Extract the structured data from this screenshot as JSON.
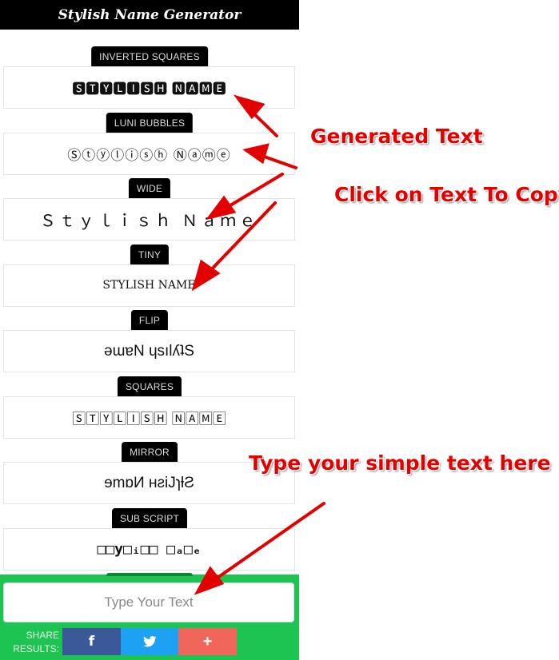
{
  "app": {
    "title": "Stylish Name Generator"
  },
  "sections": [
    {
      "label": "INVERTED SQUARES",
      "text": "🆂🆃🆈🅻🅸🆂🅷 🅽🅰🅼🅴"
    },
    {
      "label": "LUNI BUBBLES",
      "text": "Ⓢⓣⓨⓛⓘⓢⓗ Ⓝⓐⓜⓔ"
    },
    {
      "label": "WIDE",
      "text": "Ｓｔｙｌｉｓｈ Ｎａｍｅ"
    },
    {
      "label": "TINY",
      "text": "STYLISH NAME"
    },
    {
      "label": "FLIP",
      "text": "ǝɯɐN ɥsılʎʇS"
    },
    {
      "label": "SQUARES",
      "text": "🅂🅃🅈🄻🄸🅂🄷 🄽🄰🄼🄴"
    },
    {
      "label": "MIRROR",
      "text": "ɘmɒИ ʜƨiJɿƚƧ"
    },
    {
      "label": "SUB SCRIPT",
      "text": "□□y□ᵢ□□ □ₐ□ₑ"
    }
  ],
  "input": {
    "placeholder": "Type Your Text"
  },
  "share": {
    "label": "SHARE RESULTS:",
    "facebook_icon": "f",
    "twitter_icon": "twitter-bird",
    "more_icon": "+"
  },
  "annotations": {
    "generated": "Generated Text",
    "click_copy": "Click on Text To Copy",
    "type_here": "Type your simple text here"
  },
  "colors": {
    "annotation": "#e20000",
    "bottom_bar": "#1dc452",
    "facebook": "#3b5998",
    "twitter": "#1da1f2",
    "more": "#f1665b"
  }
}
